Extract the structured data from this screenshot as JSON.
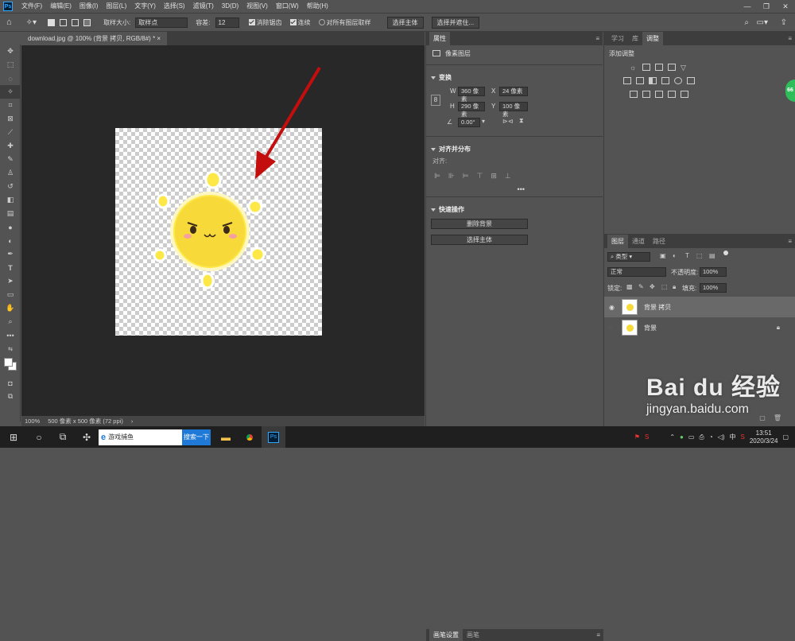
{
  "app": {
    "logo": "Ps"
  },
  "menu": [
    "文件(F)",
    "编辑(E)",
    "图像(I)",
    "图层(L)",
    "文字(Y)",
    "选择(S)",
    "滤镜(T)",
    "3D(D)",
    "视图(V)",
    "窗口(W)",
    "帮助(H)"
  ],
  "options": {
    "sample_size_label": "取样大小:",
    "sample_size_value": "取样点",
    "tolerance_label": "容差:",
    "tolerance_value": "12",
    "antialias_label": "消除锯齿",
    "contiguous_label": "连续",
    "all_layers_label": "对所有图层取样",
    "select_subject": "选择主体",
    "select_mask": "选择并遮住..."
  },
  "document": {
    "tab_title": "download.jpg @ 100% (背景 拷贝, RGB/8#) *",
    "zoom": "100%",
    "doc_size": "500 像素 x 500 像素 (72 ppi)"
  },
  "properties": {
    "tab": "属性",
    "layer_type": "像素图层",
    "transform_title": "变换",
    "w_label": "W",
    "w_value": "360 像素",
    "h_label": "H",
    "h_value": "290 像素",
    "x_label": "X",
    "x_value": "24 像素",
    "y_label": "Y",
    "y_value": "100 像素",
    "angle_value": "0.00°",
    "align_title": "对齐并分布",
    "align_label": "对齐:",
    "quick_title": "快速操作",
    "remove_bg": "删除背景",
    "select_subject": "选择主体"
  },
  "brush_tabs": [
    "画笔设置",
    "画笔"
  ],
  "adjust": {
    "tabs": [
      "学习",
      "库",
      "调整"
    ],
    "add_label": "添加调整"
  },
  "layers": {
    "tabs": [
      "图层",
      "通道",
      "路径"
    ],
    "filter_value": "类型",
    "blend_mode": "正常",
    "opacity_label": "不透明度:",
    "opacity_value": "100%",
    "lock_label": "锁定:",
    "fill_label": "填充:",
    "fill_value": "100%",
    "items": [
      {
        "name": "背景 拷贝"
      },
      {
        "name": "背景"
      }
    ]
  },
  "taskbar": {
    "search_placeholder": "游戏捕鱼",
    "search_button": "搜索一下",
    "ime": "中",
    "time": "13:51",
    "date": "2020/3/24"
  },
  "watermark": {
    "brand": "Bai du 经验",
    "url": "jingyan.baidu.com"
  },
  "badge": "66"
}
